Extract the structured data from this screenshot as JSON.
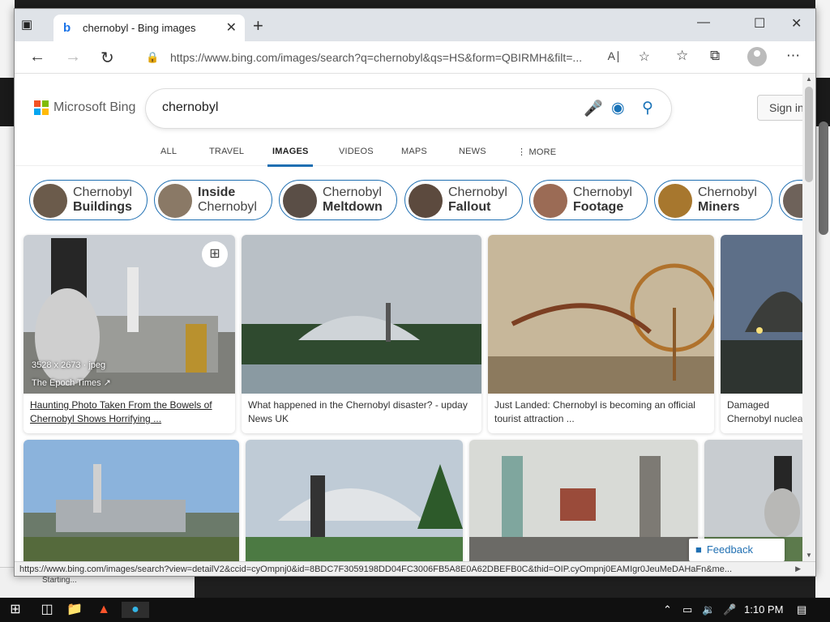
{
  "behind": {
    "status": "Starting..."
  },
  "tab": {
    "title": "chernobyl - Bing images"
  },
  "address": {
    "url": "https://www.bing.com/images/search?q=chernobyl&qs=HS&form=QBIRMH&filt=..."
  },
  "bing": {
    "brand": "Microsoft Bing",
    "query": "chernobyl",
    "signin": "Sign in",
    "nav": [
      "ALL",
      "TRAVEL",
      "IMAGES",
      "VIDEOS",
      "MAPS",
      "NEWS",
      "MORE"
    ],
    "active_nav": "IMAGES"
  },
  "pills": [
    {
      "line1": "Chernobyl",
      "line2": "Buildings",
      "bold": "line2"
    },
    {
      "line1": "Inside",
      "line2": "Chernobyl",
      "bold": "line1"
    },
    {
      "line1": "Chernobyl",
      "line2": "Meltdown",
      "bold": "line2"
    },
    {
      "line1": "Chernobyl",
      "line2": "Fallout",
      "bold": "line2"
    },
    {
      "line1": "Chernobyl",
      "line2": "Footage",
      "bold": "line2"
    },
    {
      "line1": "Chernobyl",
      "line2": "Miners",
      "bold": "line2"
    }
  ],
  "results": [
    {
      "caption": "Haunting Photo Taken From the Bowels of Chernobyl Shows Horrifying ...",
      "meta": "3528 x 2673 · jpeg",
      "source": "The Epoch Times"
    },
    {
      "caption": "What happened in the Chernobyl disaster? - upday News UK"
    },
    {
      "caption": "Just Landed: Chernobyl is becoming an official tourist attraction ..."
    },
    {
      "caption": "Damaged Chernobyl nuclear disaster ..."
    }
  ],
  "feedback": "Feedback",
  "status_url": "https://www.bing.com/images/search?view=detailV2&ccid=cyOmpnj0&id=8BDC7F3059198DD04FC3006FB5A8E0A62DBEFB0C&thid=OIP.cyOmpnj0EAMIgr0JeuMeDAHaFn&me...",
  "taskbar": {
    "time": "1:10 PM"
  },
  "colors": {
    "accent": "#1f6fb2",
    "taskbar": "#101010"
  }
}
